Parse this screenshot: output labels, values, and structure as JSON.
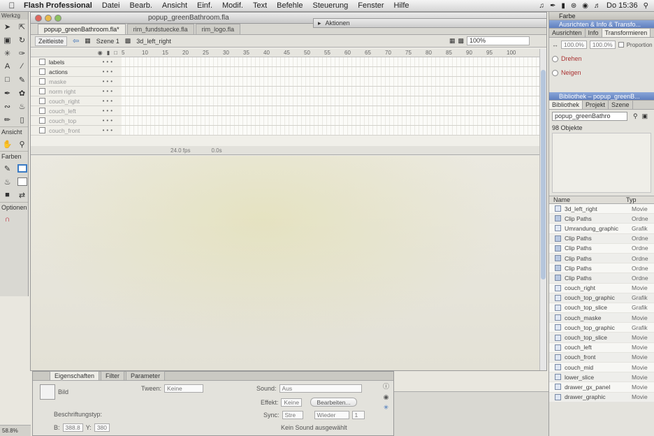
{
  "menubar": {
    "app_name": "Flash Professional",
    "items": [
      "Datei",
      "Bearb.",
      "Ansicht",
      "Einf.",
      "Modif.",
      "Text",
      "Befehle",
      "Steuerung",
      "Fenster",
      "Hilfe"
    ],
    "clock": "Do 15:36"
  },
  "tools": {
    "title": "Werkzg",
    "section_view": "Ansicht",
    "section_colors": "Farben",
    "section_options": "Optionen",
    "icons": [
      "selection-icon",
      "subselection-icon",
      "free-transform-icon",
      "3d-rotation-icon",
      "lasso-icon",
      "pen-icon",
      "text-icon",
      "line-icon",
      "rectangle-icon",
      "pencil-icon",
      "brush-icon",
      "deco-icon",
      "bone-icon",
      "paint-bucket-icon",
      "eyedropper-icon",
      "eraser-icon",
      "hand-icon",
      "zoom-icon"
    ]
  },
  "document": {
    "window_title": "popup_greenBathroom.fla",
    "tabs": [
      "popup_greenBathroom.fla*",
      "rim_fundstuecke.fla",
      "rim_logo.fla"
    ],
    "timeline_label": "Zeitleiste",
    "scene_label": "Szene 1",
    "symbol_label": "3d_left_right",
    "zoom": "100%",
    "ruler": [
      "5",
      "10",
      "15",
      "20",
      "25",
      "30",
      "35",
      "40",
      "45",
      "50",
      "55",
      "60",
      "65",
      "70",
      "75",
      "80",
      "85",
      "90",
      "95",
      "100"
    ],
    "layers": [
      "labels",
      "actions",
      "maske",
      "norm right",
      "couch_right",
      "couch_left",
      "couch_top",
      "couch_front"
    ],
    "status_fps": "24.0 fps",
    "status_time": "0.0s"
  },
  "aktionen": {
    "label": "Aktionen"
  },
  "right": {
    "farbe_title": "Farbe",
    "ausrichten_title": "Ausrichten & Info & Transfo...",
    "tabs": [
      "Ausrichten",
      "Info",
      "Transformieren"
    ],
    "width_pct": "100.0%",
    "height_pct": "100.0%",
    "proportion_label": "Proportion",
    "rotate_label": "Drehen",
    "skew_label": "Neigen",
    "library_title": "Bibliothek – popup_greenB...",
    "library_tabs": [
      "Bibliothek",
      "Projekt",
      "Szene"
    ],
    "library_select": "popup_greenBathro",
    "object_count": "98 Objekte",
    "col_name": "Name",
    "col_type": "Typ",
    "items": [
      {
        "name": "3d_left_right",
        "type": "Movie",
        "folder": false
      },
      {
        "name": "Clip Paths",
        "type": "Ordne",
        "folder": true
      },
      {
        "name": "Umrandung_graphic",
        "type": "Grafik",
        "folder": false
      },
      {
        "name": "Clip Paths",
        "type": "Ordne",
        "folder": true
      },
      {
        "name": "Clip Paths",
        "type": "Ordne",
        "folder": true
      },
      {
        "name": "Clip Paths",
        "type": "Ordne",
        "folder": true
      },
      {
        "name": "Clip Paths",
        "type": "Ordne",
        "folder": true
      },
      {
        "name": "Clip Paths",
        "type": "Ordne",
        "folder": true
      },
      {
        "name": "couch_right",
        "type": "Movie",
        "folder": false
      },
      {
        "name": "couch_top_graphic",
        "type": "Grafik",
        "folder": false
      },
      {
        "name": "couch_top_slice",
        "type": "Grafik",
        "folder": false
      },
      {
        "name": "couch_maske",
        "type": "Movie",
        "folder": false
      },
      {
        "name": "couch_top_graphic",
        "type": "Grafik",
        "folder": false
      },
      {
        "name": "couch_top_slice",
        "type": "Movie",
        "folder": false
      },
      {
        "name": "couch_left",
        "type": "Movie",
        "folder": false
      },
      {
        "name": "couch_front",
        "type": "Movie",
        "folder": false
      },
      {
        "name": "couch_mid",
        "type": "Movie",
        "folder": false
      },
      {
        "name": "lower_slice",
        "type": "Movie",
        "folder": false
      },
      {
        "name": "drawer_gx_panel",
        "type": "Movie",
        "folder": false
      },
      {
        "name": "drawer_graphic",
        "type": "Movie",
        "folder": false
      }
    ]
  },
  "properties": {
    "tabs": [
      "Eigenschaften",
      "Filter",
      "Parameter"
    ],
    "frame_label": "Bild",
    "tween_label": "Tween:",
    "tween_value": "Keine",
    "sound_label": "Sound:",
    "sound_value": "Aus",
    "effect_label": "Effekt:",
    "effect_value": "Keine",
    "edit_button": "Bearbeiten...",
    "sync_label": "Sync:",
    "sync_value": "Stre",
    "repeat_value": "Wieder",
    "repeat_count": "1",
    "label_type": "Beschriftungstyp:",
    "no_sound": "Kein Sound ausgewählt",
    "w_label": "B:",
    "w_value": "388.8",
    "y_label": "Y:",
    "y_value": "380"
  },
  "status": {
    "zoom": "58.8%"
  }
}
